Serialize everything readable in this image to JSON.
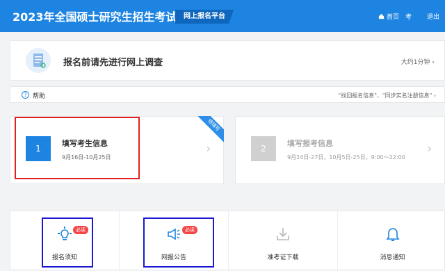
{
  "header": {
    "title": "2023年全国硕士研究生招生考试",
    "badge": "网上报名平台",
    "nav": {
      "home": "首页",
      "exam": "考",
      "exit": "退出"
    }
  },
  "survey": {
    "text": "报名前请先进行网上调查",
    "time": "大约1分钟"
  },
  "help": {
    "label": "帮助",
    "note": "\"找回报名信息\"、\"同步实名注册信息\""
  },
  "steps": [
    {
      "num": "1",
      "title": "填写考生信息",
      "dates": "9月16日-10月25日",
      "ribbon": "待填写"
    },
    {
      "num": "2",
      "title": "填写报考信息",
      "dates": "9月24日-27日，10月5日-25日，9:00～22:00"
    }
  ],
  "tiles": [
    {
      "label": "报名须知",
      "badge": "必读",
      "icon": "lightbulb-icon"
    },
    {
      "label": "网报公告",
      "badge": "必读",
      "icon": "megaphone-icon"
    },
    {
      "label": "准考证下载",
      "icon": "download-icon"
    },
    {
      "label": "消息通知",
      "icon": "bell-icon"
    }
  ],
  "colors": {
    "primary": "#1d84e2",
    "highlight_red": "#e41e1e",
    "highlight_blue": "#1a18d0"
  }
}
